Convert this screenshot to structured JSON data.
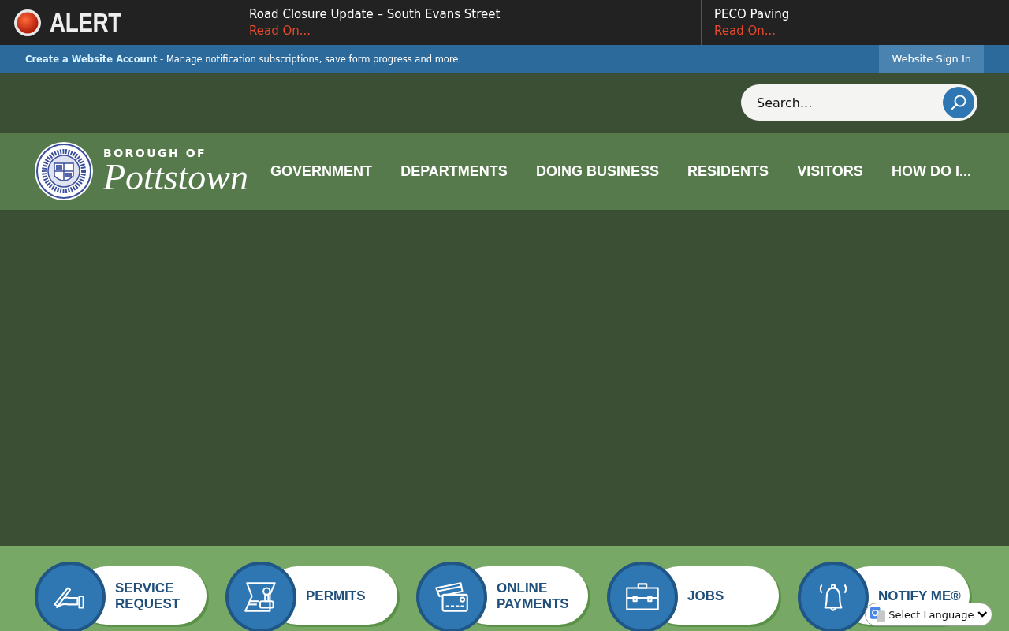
{
  "alert": {
    "label": "ALERT",
    "items": [
      {
        "title": "Road Closure Update – South Evans Street",
        "link": "Read On..."
      },
      {
        "title": "PECO Paving",
        "link": "Read On..."
      }
    ]
  },
  "account_bar": {
    "link": "Create a Website Account",
    "text": " - Manage notification subscriptions, save form progress and more.",
    "sign_in": "Website Sign In"
  },
  "search": {
    "placeholder": "Search..."
  },
  "logo": {
    "small": "BOROUGH OF",
    "name": "Pottstown"
  },
  "nav": [
    "GOVERNMENT",
    "DEPARTMENTS",
    "DOING BUSINESS",
    "RESIDENTS",
    "VISITORS",
    "HOW DO I..."
  ],
  "quick_links": [
    {
      "kind": "service",
      "label": "SERVICE REQUEST"
    },
    {
      "kind": "permits",
      "label": "PERMITS"
    },
    {
      "kind": "payments",
      "label": "ONLINE PAYMENTS"
    },
    {
      "kind": "jobs",
      "label": "JOBS"
    },
    {
      "kind": "notify",
      "label": "NOTIFY ME®"
    }
  ],
  "language": {
    "label": "Select Language"
  }
}
